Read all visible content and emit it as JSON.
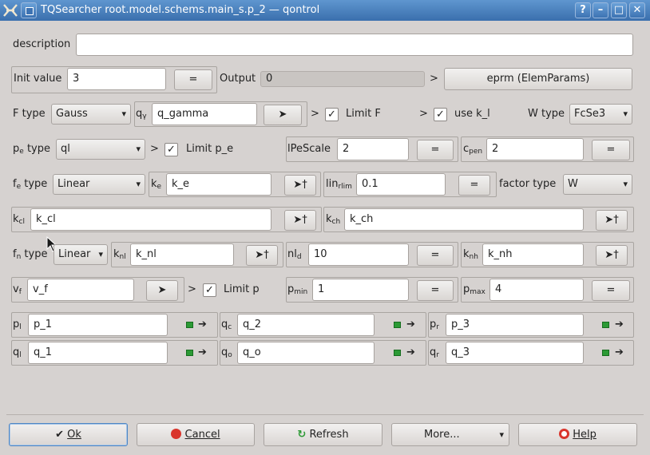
{
  "window": {
    "title": "TQSearcher root.model.schems.main_s.p_2 — qontrol",
    "buttons": {
      "help": "?",
      "minimize": "–",
      "maximize": "□",
      "close": "✕"
    }
  },
  "description": {
    "label": "description",
    "value": ""
  },
  "init": {
    "label": "Init value",
    "value": "3",
    "eq": "=",
    "output_label": "Output",
    "output_value": "0",
    "gt": ">",
    "eprm": "eprm (ElemParams)"
  },
  "f_row": {
    "label": "F type",
    "type": "Gauss",
    "q_label": "q",
    "q_sub": "γ",
    "q_value": "q_gamma",
    "go": "➤",
    "gt1": ">",
    "limit_f_checked": "✓",
    "limit_f": "Limit F",
    "gt2": ">",
    "use_kl_checked": "✓",
    "use_kl": "use k_l",
    "w_label": "W type",
    "w_type": "FcSe3"
  },
  "pe_row": {
    "label_main": "p",
    "label_sub": "e",
    "label_rest": " type",
    "type": "ql",
    "gt": ">",
    "limit_pe_checked": "✓",
    "limit_pe": "Limit p_e",
    "lpescale_label": "lPeScale",
    "lpescale": "2",
    "eq1": "=",
    "cpen_main": "c",
    "cpen_sub": "pen",
    "cpen": "2",
    "eq2": "="
  },
  "fe_row": {
    "label_main": "f",
    "label_sub": "e",
    "label_rest": " type",
    "type": "Linear",
    "ke_main": "k",
    "ke_sub": "e",
    "ke": "k_e",
    "go": "➤†",
    "lin_main": "lin",
    "lin_sub": "rlim",
    "lin": "0.1",
    "eq": "=",
    "factor_label": "factor type",
    "factor": "W"
  },
  "k_row": {
    "kcl_main": "k",
    "kcl_sub": "cl",
    "kcl": "k_cl",
    "go1": "➤†",
    "kch_main": "k",
    "kch_sub": "ch",
    "kch": "k_ch",
    "go2": "➤†"
  },
  "fn_row": {
    "label_main": "f",
    "label_sub": "n",
    "label_rest": " type",
    "type": "Linear",
    "knl_main": "k",
    "knl_sub": "nl",
    "knl": "k_nl",
    "go1": "➤†",
    "nld_main": "nl",
    "nld_sub": "d",
    "nld": "10",
    "eq": "=",
    "knh_main": "k",
    "knh_sub": "nh",
    "knh": "k_nh",
    "go2": "➤†"
  },
  "vf_row": {
    "vf_main": "v",
    "vf_sub": "f",
    "vf": "v_f",
    "go": "➤",
    "gt": ">",
    "limit_p_checked": "✓",
    "limit_p": "Limit p",
    "pmin_main": "p",
    "pmin_sub": "min",
    "pmin": "1",
    "eq1": "=",
    "pmax_main": "p",
    "pmax_sub": "max",
    "pmax": "4",
    "eq2": "="
  },
  "p_row": {
    "pl_main": "p",
    "pl_sub": "l",
    "pl": "p_1",
    "pc_main": "q",
    "pc_sub": "c",
    "pc": "q_2",
    "pr_main": "p",
    "pr_sub": "r",
    "pr": "p_3",
    "arrow": "➔"
  },
  "q_row": {
    "ql_main": "q",
    "ql_sub": "l",
    "ql": "q_1",
    "qo_main": "q",
    "qo_sub": "o",
    "qo": "q_o",
    "qr_main": "q",
    "qr_sub": "r",
    "qr": "q_3",
    "arrow": "➔"
  },
  "footer": {
    "ok": "Ok",
    "cancel": "Cancel",
    "refresh": "Refresh",
    "more": "More...",
    "help": "Help"
  },
  "colors": {
    "titlebar": "#3a6fad",
    "background": "#d6d2d0",
    "accent_green": "#2c9a35"
  }
}
